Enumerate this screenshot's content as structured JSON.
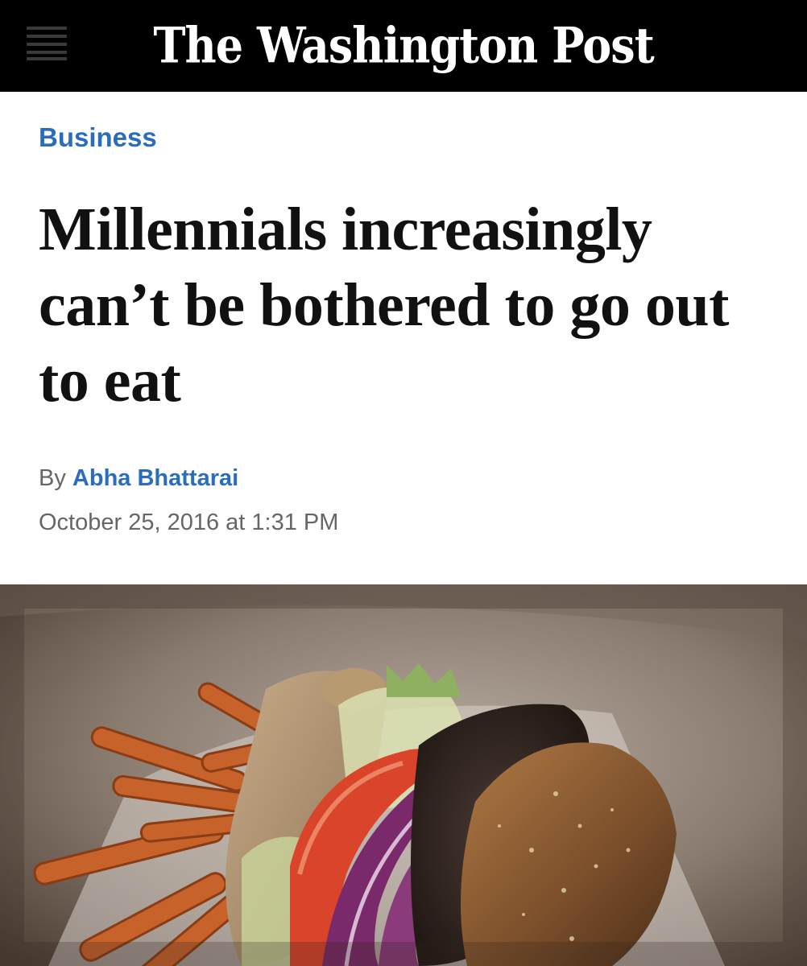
{
  "header": {
    "masthead": "The Washington Post",
    "menu_icon": "hamburger-menu-icon",
    "background": "#000000"
  },
  "article": {
    "section": "Business",
    "headline": "Millennials increasingly can’t be bothered to go out to eat",
    "byline_prefix": "By",
    "author": "Abha Bhattarai",
    "timestamp": "October 25, 2016 at 1:31 PM",
    "lead_image": "burger-and-sweet-potato-fries-photo"
  },
  "colors": {
    "link_blue": "#2a6ebb",
    "headline": "#111111",
    "meta_gray": "#666666"
  }
}
